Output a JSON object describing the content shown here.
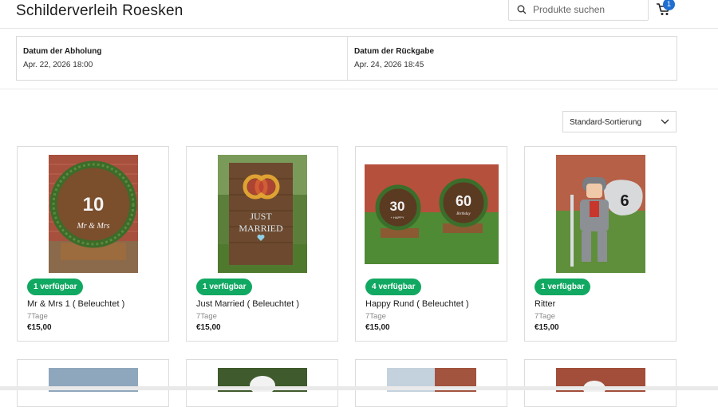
{
  "header": {
    "brand": "Schilderverleih Roesken",
    "search_placeholder": "Produkte suchen",
    "cart_count": "1"
  },
  "dates": {
    "pickup_label": "Datum der Abholung",
    "pickup_value": "Apr. 22, 2026 18:00",
    "return_label": "Datum der Rückgabe",
    "return_value": "Apr. 24, 2026 18:45"
  },
  "sort": {
    "selected": "Standard-Sortierung"
  },
  "products": [
    {
      "badge": "1 verfügbar",
      "title": "Mr & Mrs 1 ( Beleuchtet )",
      "duration": "7Tage",
      "price": "€15,00",
      "sign_number": "10",
      "sign_text": "Mr & Mrs"
    },
    {
      "badge": "1 verfügbar",
      "title": "Just Married ( Beleuchtet )",
      "duration": "7Tage",
      "price": "€15,00",
      "sign_line1": "JUST",
      "sign_line2": "MARRIED"
    },
    {
      "badge": "4 verfügbar",
      "title": "Happy Rund ( Beleuchtet )",
      "duration": "7Tage",
      "price": "€15,00",
      "sign_left": "30",
      "sign_right": "60",
      "sign_small": "+ HAPPY",
      "sign_script": "Birthday"
    },
    {
      "badge": "1 verfügbar",
      "title": "Ritter",
      "duration": "7Tage",
      "price": "€15,00",
      "sign_number": "6"
    }
  ],
  "colors": {
    "accent_green": "#11a862",
    "badge_blue": "#1f6fd1"
  }
}
